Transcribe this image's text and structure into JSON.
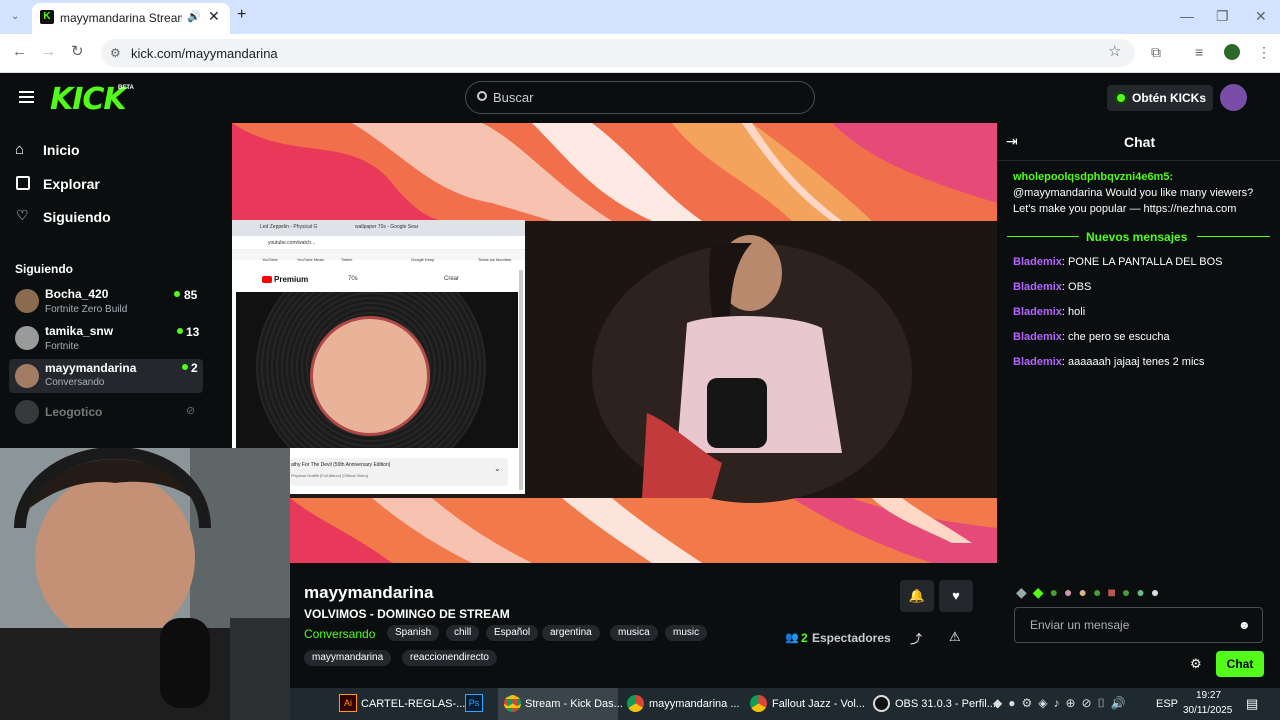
{
  "browser": {
    "tab_title": "mayymandarina Stream - W",
    "url": "kick.com/mayymandarina"
  },
  "header": {
    "logo": "KICK",
    "beta": "BETA",
    "search_placeholder": "Buscar",
    "kicks_button": "Obtén KICKs"
  },
  "sidebar": {
    "nav": [
      "Inicio",
      "Explorar",
      "Siguiendo"
    ],
    "following_title": "Siguiendo",
    "channels": [
      {
        "name": "Bocha_420",
        "category": "Fortnite Zero Build",
        "viewers": "85"
      },
      {
        "name": "tamika_snw",
        "category": "Fortnite",
        "viewers": "13"
      },
      {
        "name": "mayymandarina",
        "category": "Conversando",
        "viewers": "2"
      },
      {
        "name": "Leogotico",
        "category": "",
        "viewers": ""
      }
    ]
  },
  "embedded_browser": {
    "tab1": "Led Zeppelin - Physical G",
    "tab2": "wallpaper 70s - Google Sear",
    "url": "youtube.com/watch...",
    "bookmarks": [
      "YouTube",
      "YouTube Music",
      "Twitch",
      "Google Keep",
      "Todos los favoritos"
    ],
    "premium": "Premium",
    "search_chip": "70s",
    "create": "Crear",
    "song": "athy For The Devil (50th Anniversary Edition)",
    "song_sub": "Physical Graffiti (Full Album) [Official Video]"
  },
  "stream": {
    "name": "mayymandarina",
    "title": "VOLVIMOS - DOMINGO DE STREAM",
    "category": "Conversando",
    "tags": [
      "Spanish",
      "chill",
      "Español",
      "argentina",
      "musica",
      "music",
      "mayymandarina",
      "reaccionendirecto"
    ],
    "viewers": "2",
    "viewers_label": "Espectadores"
  },
  "chat": {
    "title": "Chat",
    "pinned_user": "wholepoolqsdphbqvzni4e6m5:",
    "pinned_text": "@mayymandarina Would you like many viewers? Let's make you popular — https://nezhna.com",
    "new_messages": "Nuevos mensajes",
    "messages": [
      {
        "user": "Blademix",
        "text": "PONE LA PANTALLA DEL BOS"
      },
      {
        "user": "Blademix",
        "text": "OBS"
      },
      {
        "user": "Blademix",
        "text": "holi"
      },
      {
        "user": "Blademix",
        "text": "che pero se escucha"
      },
      {
        "user": "Blademix",
        "text": "aaaaaah jajaaj tenes 2 mics"
      }
    ],
    "input_placeholder": "Enviar un mensaje",
    "send_button": "Chat"
  },
  "taskbar": {
    "items": [
      "CARTEL-REGLAS-...",
      "Stream - Kick Das...",
      "mayymandarina ...",
      "Fallout Jazz - Vol...",
      "OBS 31.0.3 - Perfil..."
    ],
    "lang": "ESP",
    "time": "19:27",
    "date": "30/11/2025"
  },
  "colors": {
    "accent": "#53fc18",
    "chat_user": "#b664ff",
    "bg": "#0b0e0f"
  }
}
